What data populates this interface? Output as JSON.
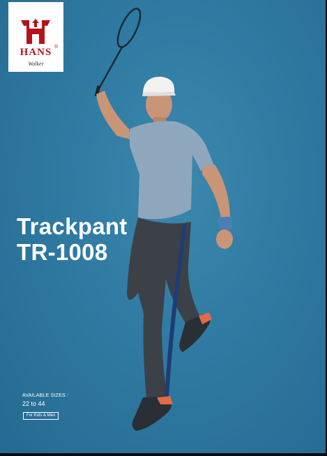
{
  "brand": {
    "name": "HANS",
    "registered_mark": "®",
    "tagline": "Walker"
  },
  "product": {
    "name": "Trackpant",
    "code": "TR-1008"
  },
  "sizes": {
    "label": "AVAILABLE SIZES :",
    "range": "22 to 44",
    "audience": "For Kids & Men"
  },
  "colors": {
    "background": "#2f7aa2",
    "logo_red": "#b5121b",
    "text": "#ffffff"
  }
}
